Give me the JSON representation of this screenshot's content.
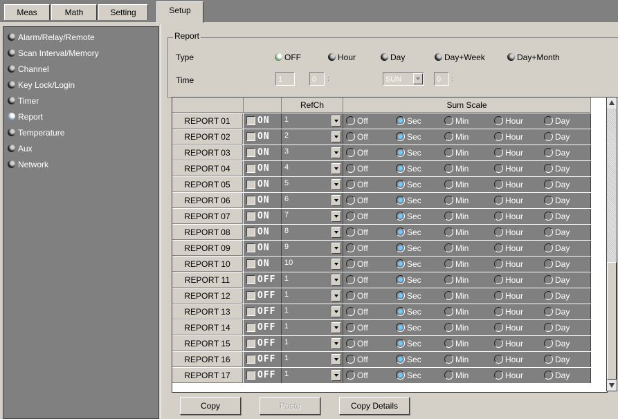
{
  "tabs": [
    "Meas",
    "Math",
    "Setting",
    "Setup"
  ],
  "active_tab": "Setup",
  "sidebar": {
    "items": [
      {
        "label": "Alarm/Relay/Remote",
        "selected": false
      },
      {
        "label": "Scan Interval/Memory",
        "selected": false
      },
      {
        "label": "Channel",
        "selected": false
      },
      {
        "label": "Key Lock/Login",
        "selected": false
      },
      {
        "label": "Timer",
        "selected": false
      },
      {
        "label": "Report",
        "selected": true
      },
      {
        "label": "Temperature",
        "selected": false
      },
      {
        "label": "Aux",
        "selected": false
      },
      {
        "label": "Network",
        "selected": false
      }
    ]
  },
  "report": {
    "group_title": "Report",
    "type_label": "Type",
    "type_options": [
      "OFF",
      "Hour",
      "Day",
      "Day+Week",
      "Day+Month"
    ],
    "type_selected": "OFF",
    "time_label": "Time",
    "time_hour": "1",
    "time_min": "0",
    "time_day": "SUN",
    "time_min2": "0",
    "sep1": ":",
    "sep2": ":"
  },
  "grid": {
    "headers": {
      "blank": "",
      "refch": "RefCh",
      "sum_scale": "Sum Scale"
    },
    "scale_options": [
      "Off",
      "Sec",
      "Min",
      "Hour",
      "Day"
    ],
    "rows": [
      {
        "name": "REPORT 01",
        "state": "ON",
        "refch": "1",
        "scale": "Sec"
      },
      {
        "name": "REPORT 02",
        "state": "ON",
        "refch": "2",
        "scale": "Sec"
      },
      {
        "name": "REPORT 03",
        "state": "ON",
        "refch": "3",
        "scale": "Sec"
      },
      {
        "name": "REPORT 04",
        "state": "ON",
        "refch": "4",
        "scale": "Sec"
      },
      {
        "name": "REPORT 05",
        "state": "ON",
        "refch": "5",
        "scale": "Sec"
      },
      {
        "name": "REPORT 06",
        "state": "ON",
        "refch": "6",
        "scale": "Sec"
      },
      {
        "name": "REPORT 07",
        "state": "ON",
        "refch": "7",
        "scale": "Sec"
      },
      {
        "name": "REPORT 08",
        "state": "ON",
        "refch": "8",
        "scale": "Sec"
      },
      {
        "name": "REPORT 09",
        "state": "ON",
        "refch": "9",
        "scale": "Sec"
      },
      {
        "name": "REPORT 10",
        "state": "ON",
        "refch": "10",
        "scale": "Sec"
      },
      {
        "name": "REPORT 11",
        "state": "OFF",
        "refch": "1",
        "scale": "Sec"
      },
      {
        "name": "REPORT 12",
        "state": "OFF",
        "refch": "1",
        "scale": "Sec"
      },
      {
        "name": "REPORT 13",
        "state": "OFF",
        "refch": "1",
        "scale": "Sec"
      },
      {
        "name": "REPORT 14",
        "state": "OFF",
        "refch": "1",
        "scale": "Sec"
      },
      {
        "name": "REPORT 15",
        "state": "OFF",
        "refch": "1",
        "scale": "Sec"
      },
      {
        "name": "REPORT 16",
        "state": "OFF",
        "refch": "1",
        "scale": "Sec"
      },
      {
        "name": "REPORT 17",
        "state": "OFF",
        "refch": "1",
        "scale": "Sec"
      }
    ]
  },
  "buttons": {
    "copy": "Copy",
    "paste": "Paste",
    "copy_details": "Copy Details"
  },
  "colors": {
    "panel": "#d4d0c8",
    "dark": "#808080",
    "selected_radio": "#6ec8ff"
  }
}
